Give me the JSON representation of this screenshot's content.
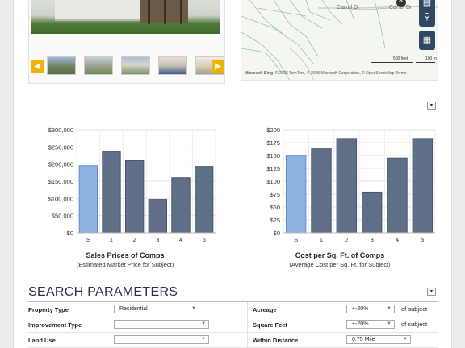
{
  "map": {
    "street_labels": [
      "Carrol Dr",
      "Carrol Dr"
    ],
    "scale_labels": [
      "500 feet",
      "100 m"
    ],
    "attribution": "© 2025 TomTom, © 2025 Microsoft Corporation, © OpenStreetMap  Terms",
    "bing_logo": "Microsoft Bing",
    "buttons": [
      "layers-icon",
      "search-icon",
      "ruler-icon"
    ],
    "marker": "S"
  },
  "photos": {
    "prev_icon": "◀",
    "next_icon": "▶",
    "thumb_colors": [
      "#6b7f5a",
      "#8fa07a",
      "#7b936a",
      "#4d5e79",
      "#c9c2b4"
    ]
  },
  "colors": {
    "subject_bar": "#8db3e2",
    "comp_bar": "#5f6f87",
    "accent": "#f0b400",
    "section_title": "#23344e"
  },
  "chart_data": [
    {
      "type": "bar",
      "title": "Sales Prices of Comps",
      "subtitle": "(Estimated Market Price for Subject)",
      "categories": [
        "S",
        "1",
        "2",
        "3",
        "4",
        "5"
      ],
      "values": [
        195000,
        237000,
        210000,
        97000,
        160000,
        193000
      ],
      "ylim": [
        0,
        300000
      ],
      "yticks": [
        "$0",
        "$50,000",
        "$100,000",
        "$150,000",
        "$200,000",
        "$250,000",
        "$300,000"
      ],
      "grid": true,
      "legend": "none"
    },
    {
      "type": "bar",
      "title": "Cost per Sq. Ft. of Comps",
      "subtitle": "(Average Cost per Sq. Ft. for Subject)",
      "categories": [
        "S",
        "1",
        "2",
        "3",
        "4",
        "5"
      ],
      "values": [
        150,
        163,
        183,
        79,
        145,
        183
      ],
      "ylim": [
        0,
        200
      ],
      "yticks": [
        "$0",
        "$25",
        "$50",
        "$75",
        "$100",
        "$125",
        "$150",
        "$175",
        "$200"
      ],
      "grid": true,
      "legend": "none"
    }
  ],
  "search": {
    "title": "SEARCH PARAMETERS",
    "collapse_icon": "▾",
    "rows": [
      {
        "left_label": "Property Type",
        "left_value": "Residential",
        "right_label": "Acreage",
        "right_value": "+-20%",
        "right_suffix": "of subject"
      },
      {
        "left_label": "Improvement Type",
        "left_value": "",
        "right_label": "Square Feet",
        "right_value": "+-20%",
        "right_suffix": "of subject"
      },
      {
        "left_label": "Land Use",
        "left_value": "",
        "right_label": "Within Distance",
        "right_value": "0.75 Mile",
        "right_suffix": ""
      }
    ]
  }
}
